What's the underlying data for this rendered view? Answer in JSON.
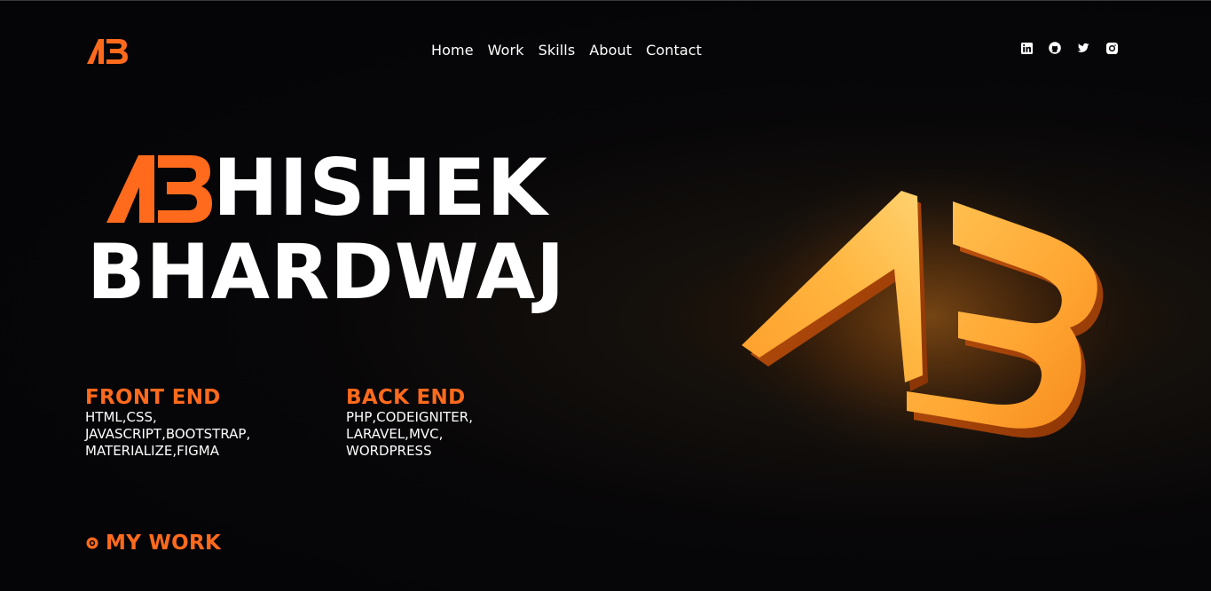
{
  "header": {
    "logo_alt": "AB",
    "nav": [
      {
        "label": "Home"
      },
      {
        "label": "Work"
      },
      {
        "label": "Skills"
      },
      {
        "label": "About"
      },
      {
        "label": "Contact"
      }
    ],
    "social": [
      {
        "icon": "linkedin-icon"
      },
      {
        "icon": "github-icon"
      },
      {
        "icon": "twitter-icon"
      },
      {
        "icon": "instagram-icon"
      }
    ]
  },
  "hero": {
    "line1_suffix": "HISHEK",
    "line2": "BHARDWAJ"
  },
  "skills": {
    "front": {
      "title": "FRONT END",
      "lines": [
        "HTML,CSS,",
        "JAVASCRIPT,BOOTSTRAP,",
        "MATERIALIZE,FIGMA"
      ]
    },
    "back": {
      "title": "BACK END",
      "lines": [
        "PHP,CODEIGNITER,",
        "LARAVEL,MVC,",
        "WORDPRESS"
      ]
    }
  },
  "mywork": {
    "label": "MY WORK"
  },
  "colors": {
    "accent": "#ff6a1c",
    "text": "#ffffff",
    "background": "#050507",
    "logo_glow": "#ffb33a"
  }
}
